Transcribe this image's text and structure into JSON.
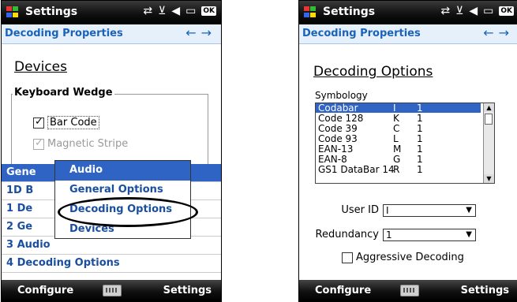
{
  "left": {
    "title": "Settings",
    "subtitle": "Decoding Properties",
    "page_title": "Devices",
    "group_label": "Keyboard Wedge",
    "checks": [
      {
        "label": "Bar Code",
        "checked": true,
        "enabled": true
      },
      {
        "label": "Magnetic Stripe",
        "checked": true,
        "enabled": false
      }
    ],
    "menu_items": [
      "Gene",
      "1D B",
      "1 De",
      "2 Ge",
      "3 Audio",
      "4 Decoding Options"
    ],
    "popup_items": [
      "Audio",
      "General Options",
      "Decoding Options",
      "Devices"
    ],
    "softkey_left": "Configure",
    "softkey_right": "Settings",
    "ok_label": "OK"
  },
  "right": {
    "title": "Settings",
    "subtitle": "Decoding Properties",
    "page_title": "Decoding Options",
    "symbology_label": "Symbology",
    "symbologies": [
      {
        "name": "Codabar",
        "code": "I",
        "value": "1"
      },
      {
        "name": "Code 128",
        "code": "K",
        "value": "1"
      },
      {
        "name": "Code 39",
        "code": "C",
        "value": "1"
      },
      {
        "name": "Code 93",
        "code": "L",
        "value": "1"
      },
      {
        "name": "EAN-13",
        "code": "M",
        "value": "1"
      },
      {
        "name": "EAN-8",
        "code": "G",
        "value": "1"
      },
      {
        "name": "GS1 DataBar 14",
        "code": "R",
        "value": "1"
      }
    ],
    "user_id_label": "User ID",
    "user_id_value": "I",
    "redundancy_label": "Redundancy",
    "redundancy_value": "1",
    "aggressive_label": "Aggressive Decoding",
    "aggressive_checked": false,
    "softkey_left": "Configure",
    "softkey_right": "Settings",
    "ok_label": "OK"
  },
  "colors": {
    "title_bar": "#111111",
    "selection": "#2f63c4",
    "link_text": "#1a4fa0"
  }
}
